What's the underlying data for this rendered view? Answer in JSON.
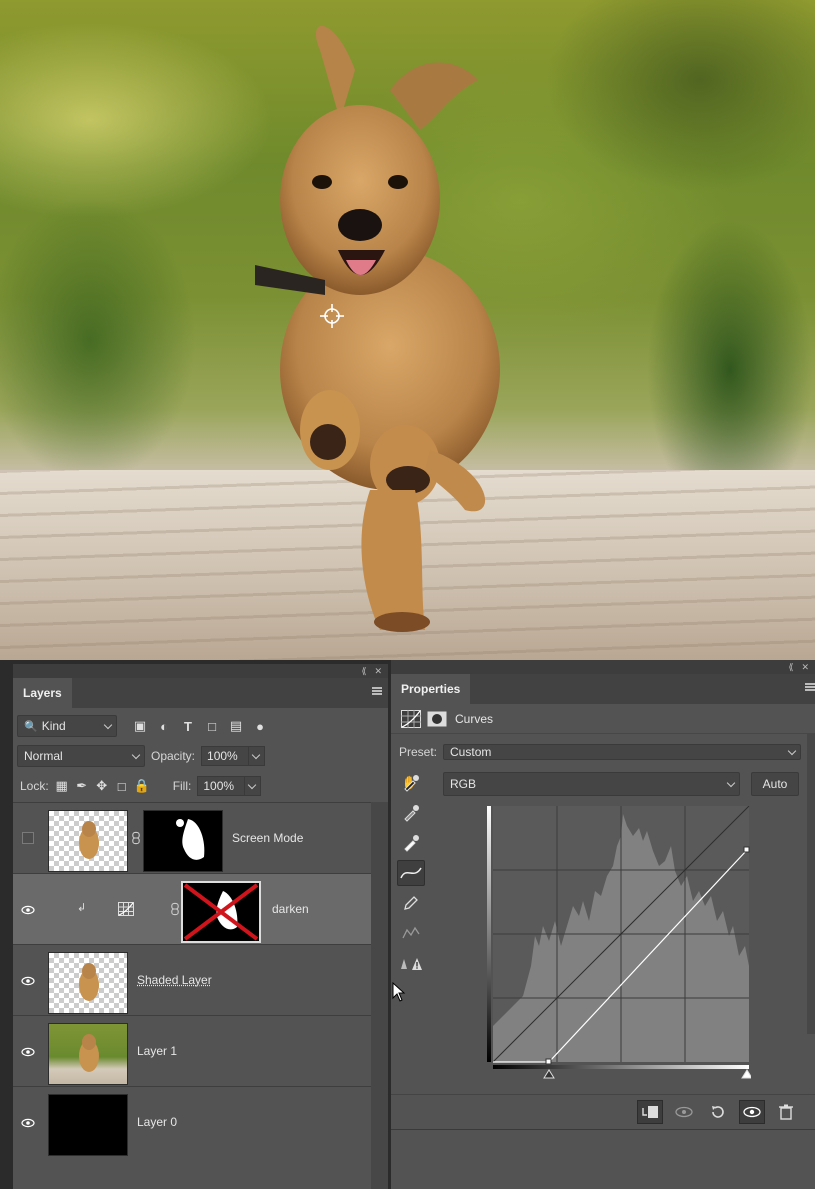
{
  "layers_panel": {
    "tab_label": "Layers",
    "filter_kind": "Kind",
    "blend_mode": "Normal",
    "opacity_label": "Opacity:",
    "opacity_value": "100%",
    "lock_label": "Lock:",
    "fill_label": "Fill:",
    "fill_value": "100%",
    "layers": [
      {
        "name": "Screen Mode",
        "visible": false,
        "selected": false
      },
      {
        "name": "darken",
        "visible": true,
        "selected": true
      },
      {
        "name": "Shaded Layer",
        "visible": true,
        "selected": false
      },
      {
        "name": "Layer 1",
        "visible": true,
        "selected": false
      },
      {
        "name": "Layer 0",
        "visible": true,
        "selected": false
      }
    ]
  },
  "properties_panel": {
    "tab_label": "Properties",
    "adjustment_name": "Curves",
    "preset_label": "Preset:",
    "preset_value": "Custom",
    "channel_value": "RGB",
    "auto_button": "Auto"
  },
  "icons": {
    "collapse": "double-chevron-left-icon",
    "close": "close-icon",
    "menu": "panel-menu-icon"
  },
  "colors": {
    "panel_bg": "#535353",
    "selected_row": "#6a6a6a",
    "mask_cross": "#d0141c"
  }
}
